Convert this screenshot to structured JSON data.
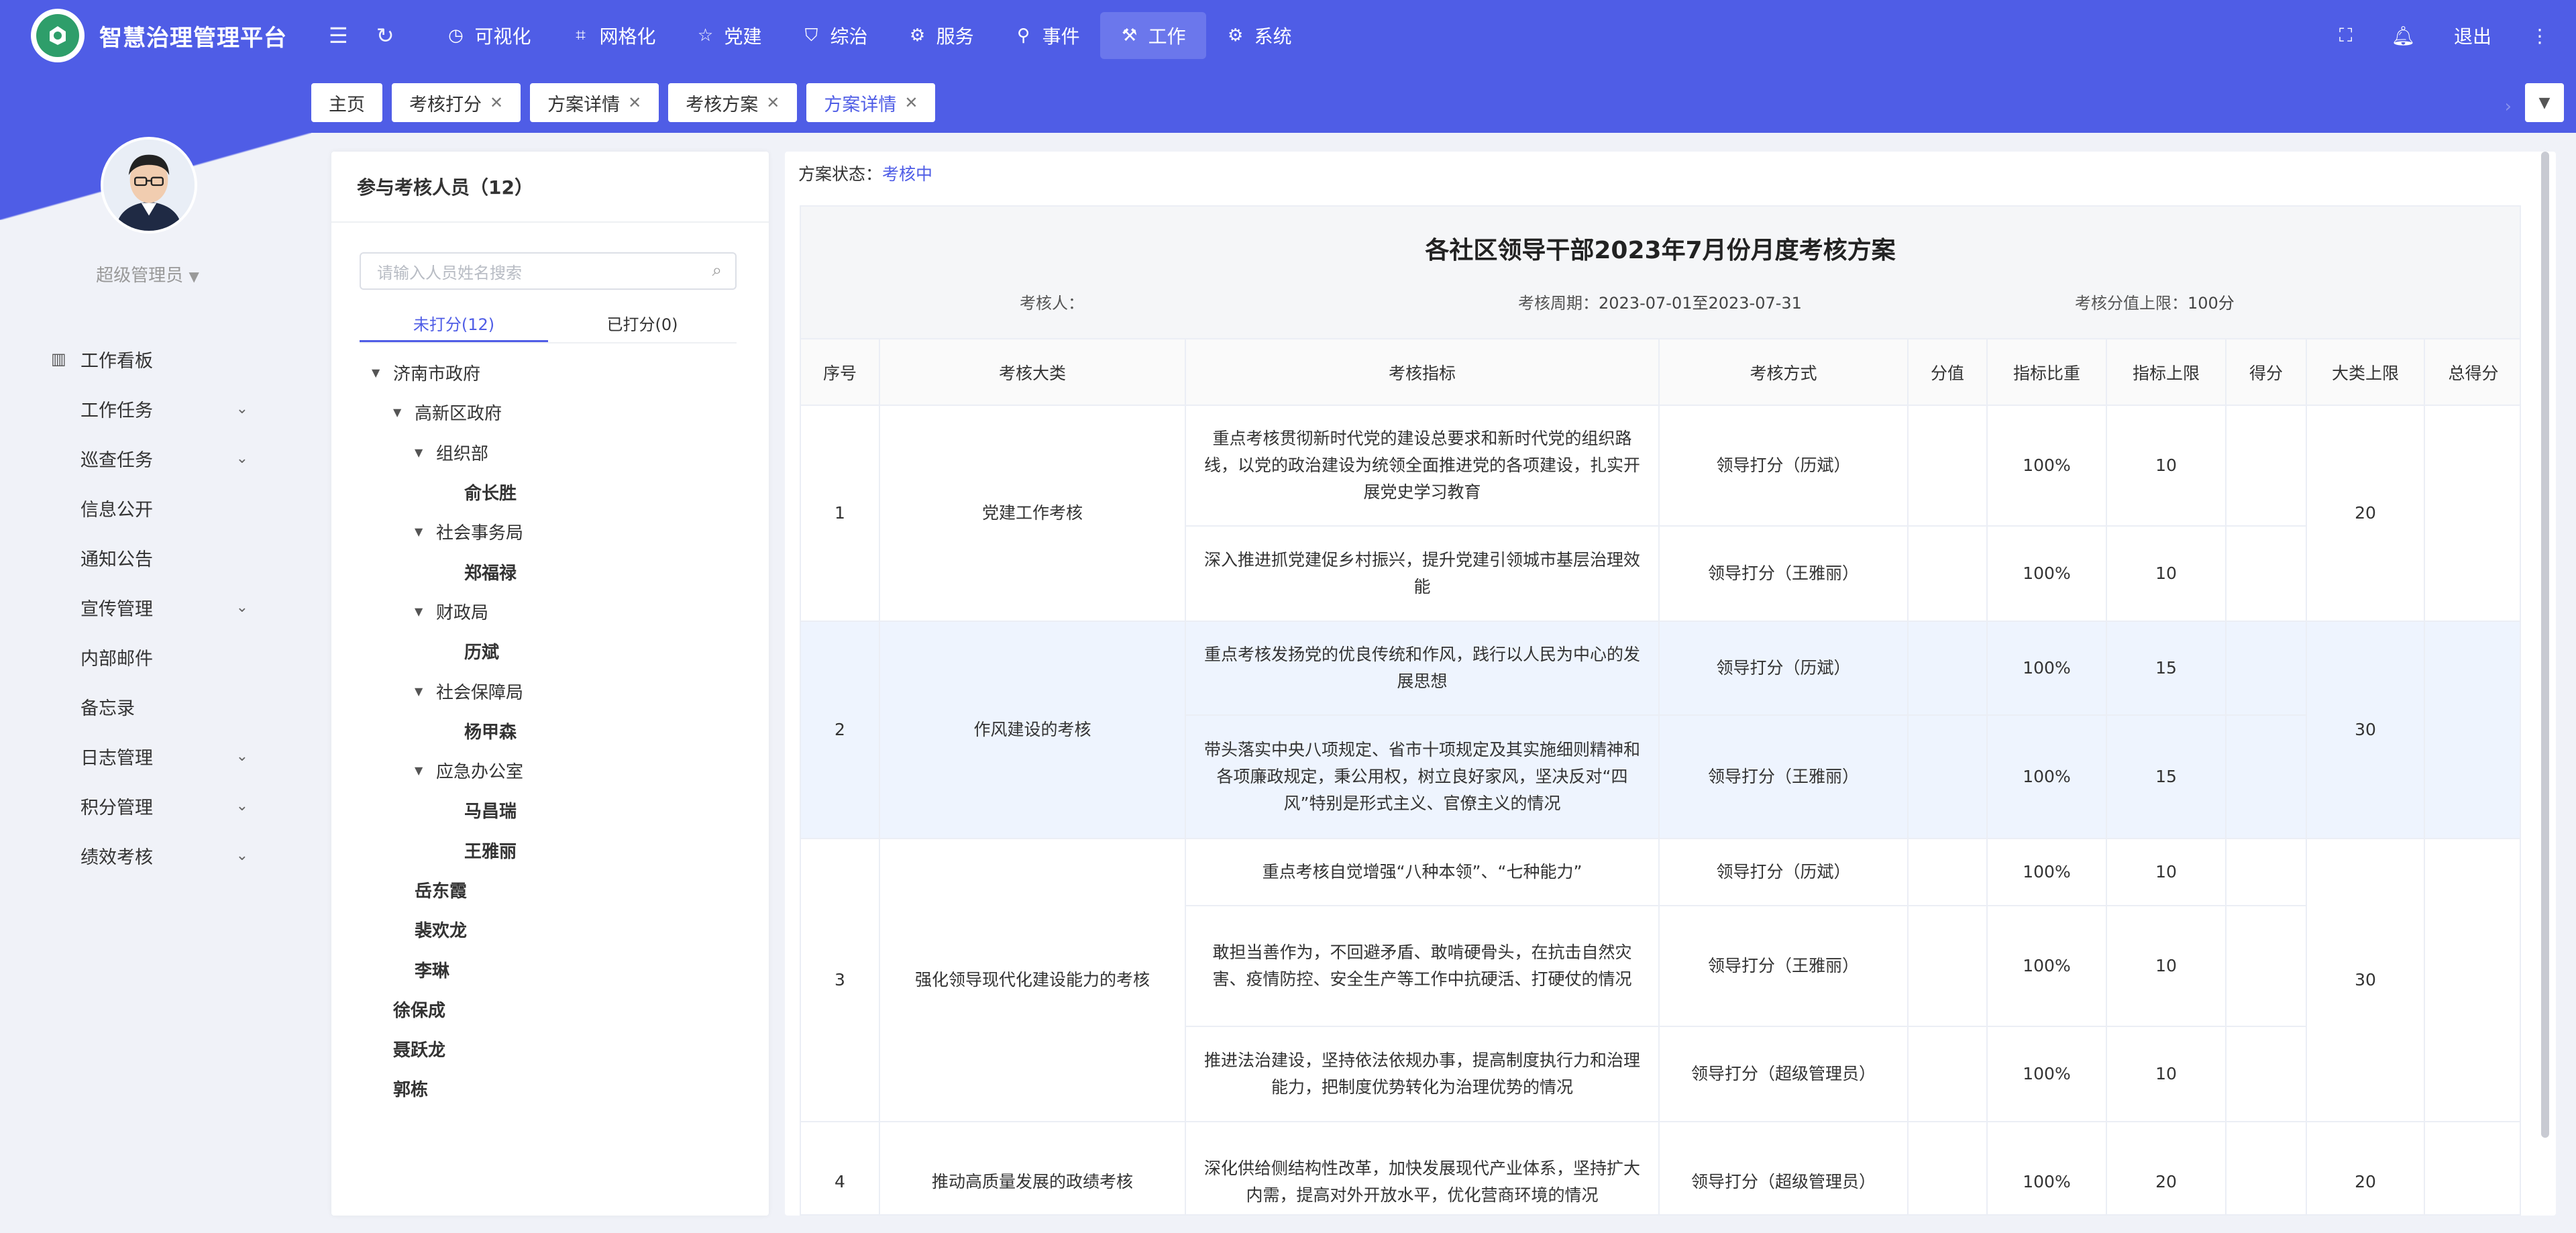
{
  "app": {
    "title": "智慧治理管理平台",
    "nav": [
      {
        "label": "可视化",
        "icon": "clock-icon"
      },
      {
        "label": "网格化",
        "icon": "grid-icon"
      },
      {
        "label": "党建",
        "icon": "star-icon"
      },
      {
        "label": "综治",
        "icon": "shield-icon"
      },
      {
        "label": "服务",
        "icon": "service-icon"
      },
      {
        "label": "事件",
        "icon": "pin-icon"
      },
      {
        "label": "工作",
        "icon": "work-icon",
        "active": true
      },
      {
        "label": "系统",
        "icon": "gear-icon"
      }
    ],
    "logout": "退出"
  },
  "tabs": [
    {
      "label": "主页"
    },
    {
      "label": "考核打分"
    },
    {
      "label": "方案详情"
    },
    {
      "label": "考核方案"
    },
    {
      "label": "方案详情",
      "active": true
    }
  ],
  "user": {
    "name": "超级管理员"
  },
  "sidebar": {
    "items": [
      {
        "label": "工作看板",
        "icon": "bar-chart-icon",
        "expandable": false
      },
      {
        "label": "工作任务",
        "expandable": true
      },
      {
        "label": "巡查任务",
        "expandable": true
      },
      {
        "label": "信息公开",
        "expandable": false
      },
      {
        "label": "通知公告",
        "expandable": false
      },
      {
        "label": "宣传管理",
        "expandable": true
      },
      {
        "label": "内部邮件",
        "expandable": false
      },
      {
        "label": "备忘录",
        "expandable": false
      },
      {
        "label": "日志管理",
        "expandable": true
      },
      {
        "label": "积分管理",
        "expandable": true
      },
      {
        "label": "绩效考核",
        "expandable": true
      }
    ]
  },
  "participants": {
    "header": "参与考核人员（12）",
    "search_placeholder": "请输入人员姓名搜索",
    "tab_unscored": "未打分(12)",
    "tab_scored": "已打分(0)",
    "tree": [
      {
        "label": "济南市政府",
        "level": 0,
        "expanded": true
      },
      {
        "label": "高新区政府",
        "level": 1,
        "expanded": true
      },
      {
        "label": "组织部",
        "level": 2,
        "expanded": true
      },
      {
        "label": "俞长胜",
        "level": 3,
        "leaf": true
      },
      {
        "label": "社会事务局",
        "level": 2,
        "expanded": true
      },
      {
        "label": "郑福禄",
        "level": 3,
        "leaf": true
      },
      {
        "label": "财政局",
        "level": 2,
        "expanded": true
      },
      {
        "label": "历斌",
        "level": 3,
        "leaf": true
      },
      {
        "label": "社会保障局",
        "level": 2,
        "expanded": true
      },
      {
        "label": "杨甲森",
        "level": 3,
        "leaf": true
      },
      {
        "label": "应急办公室",
        "level": 2,
        "expanded": true
      },
      {
        "label": "马昌瑞",
        "level": 3,
        "leaf": true
      },
      {
        "label": "王雅丽",
        "level": 3,
        "leaf": true
      },
      {
        "label": "岳东霞",
        "level": 2,
        "leaf": true
      },
      {
        "label": "裴欢龙",
        "level": 2,
        "leaf": true
      },
      {
        "label": "李琳",
        "level": 2,
        "leaf": true
      },
      {
        "label": "徐保成",
        "level": 1,
        "leaf": true
      },
      {
        "label": "聂跃龙",
        "level": 1,
        "leaf": true
      },
      {
        "label": "郭栋",
        "level": 1,
        "leaf": true
      }
    ]
  },
  "plan": {
    "status_label": "方案状态：",
    "status_value": "考核中",
    "title": "各社区领导干部2023年7月份月度考核方案",
    "assessor_label": "考核人：",
    "assessor_value": "",
    "period_label": "考核周期：",
    "period_value": "2023-07-01至2023-07-31",
    "limit_label": "考核分值上限：",
    "limit_value": "100分",
    "columns": [
      "序号",
      "考核大类",
      "考核指标",
      "考核方式",
      "分值",
      "指标比重",
      "指标上限",
      "得分",
      "大类上限",
      "总得分"
    ],
    "groups": [
      {
        "index": "1",
        "category": "党建工作考核",
        "cap": "20",
        "highlight": false,
        "rows": [
          {
            "indicator": "重点考核贯彻新时代党的建设总要求和新时代党的组织路线，以党的政治建设为统领全面推进党的各项建设，扎实开展党史学习教育",
            "method": "领导打分（历斌）",
            "score": "",
            "weight": "100%",
            "upper": "10",
            "got": ""
          },
          {
            "indicator": "深入推进抓党建促乡村振兴，提升党建引领城市基层治理效能",
            "method": "领导打分（王雅丽）",
            "score": "",
            "weight": "100%",
            "upper": "10",
            "got": ""
          }
        ]
      },
      {
        "index": "2",
        "category": "作风建设的考核",
        "cap": "30",
        "highlight": true,
        "rows": [
          {
            "indicator": "重点考核发扬党的优良传统和作风，践行以人民为中心的发展思想",
            "method": "领导打分（历斌）",
            "score": "",
            "weight": "100%",
            "upper": "15",
            "got": ""
          },
          {
            "indicator": "带头落实中央八项规定、省市十项规定及其实施细则精神和各项廉政规定，秉公用权，树立良好家风，坚决反对“四风”特别是形式主义、官僚主义的情况",
            "method": "领导打分（王雅丽）",
            "score": "",
            "weight": "100%",
            "upper": "15",
            "got": ""
          }
        ]
      },
      {
        "index": "3",
        "category": "强化领导现代化建设能力的考核",
        "cap": "30",
        "highlight": false,
        "rows": [
          {
            "indicator": "重点考核自觉增强“八种本领”、“七种能力”",
            "method": "领导打分（历斌）",
            "score": "",
            "weight": "100%",
            "upper": "10",
            "got": ""
          },
          {
            "indicator": "敢担当善作为，不回避矛盾、敢啃硬骨头，在抗击自然灾害、疫情防控、安全生产等工作中抗硬活、打硬仗的情况",
            "method": "领导打分（王雅丽）",
            "score": "",
            "weight": "100%",
            "upper": "10",
            "got": ""
          },
          {
            "indicator": "推进法治建设，坚持依法依规办事，提高制度执行力和治理能力，把制度优势转化为治理优势的情况",
            "method": "领导打分（超级管理员）",
            "score": "",
            "weight": "100%",
            "upper": "10",
            "got": ""
          }
        ]
      },
      {
        "index": "4",
        "category": "推动高质量发展的政绩考核",
        "cap": "20",
        "highlight": false,
        "rows": [
          {
            "indicator": "深化供给侧结构性改革，加快发展现代产业体系，坚持扩大内需，提高对外开放水平，优化营商环境的情况",
            "method": "领导打分（超级管理员）",
            "score": "",
            "weight": "100%",
            "upper": "20",
            "got": ""
          }
        ]
      }
    ]
  },
  "colors": {
    "brand": "#4f5de6",
    "accent_link": "#4f5de6",
    "highlight_row": "#eef4fe"
  }
}
